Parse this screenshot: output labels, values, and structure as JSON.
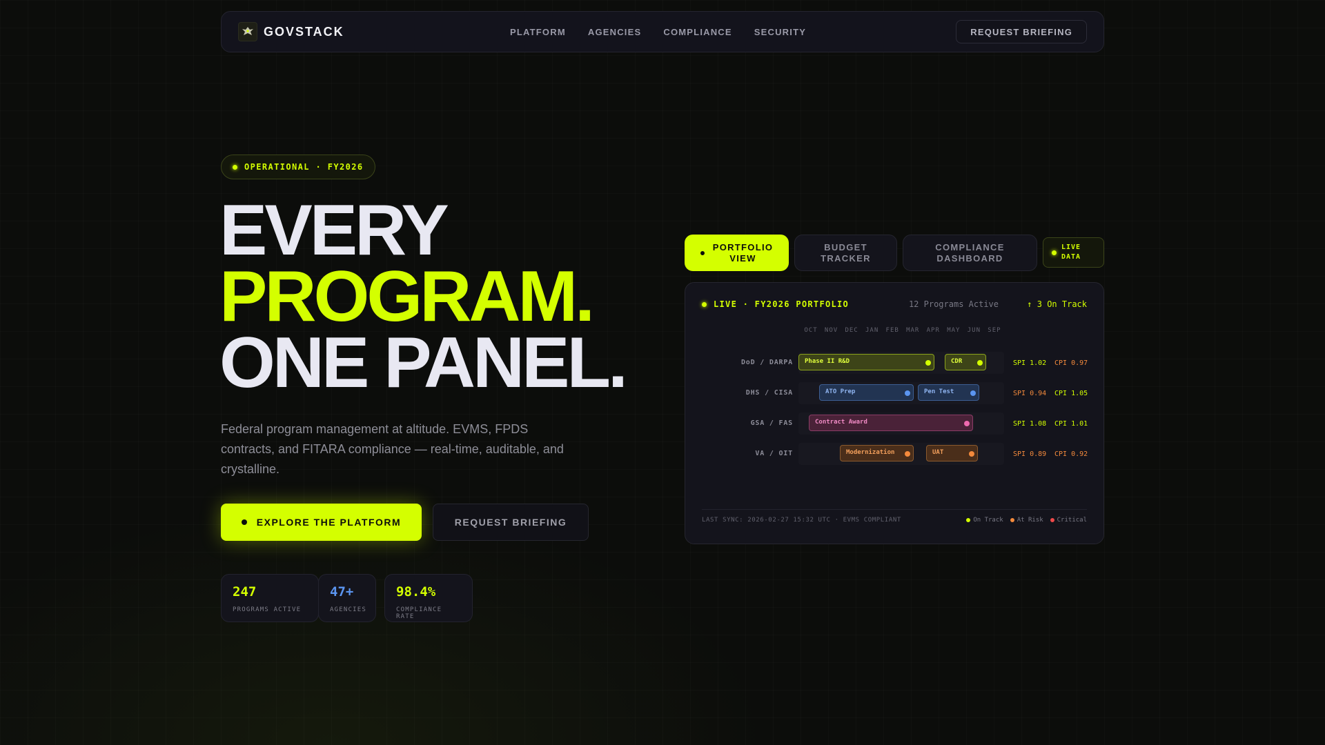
{
  "nav": {
    "brand": "GOVSTACK",
    "links": [
      "PLATFORM",
      "AGENCIES",
      "COMPLIANCE",
      "SECURITY"
    ],
    "cta": "REQUEST BRIEFING"
  },
  "hero": {
    "badge": "OPERATIONAL · FY2026",
    "line1": "EVERY",
    "line2": "PROGRAM.",
    "line3": "ONE PANEL.",
    "subtitle": "Federal program management at altitude. EVMS, FPDS contracts, and FITARA compliance — real-time, auditable, and crystalline.",
    "primary_cta": "EXPLORE THE PLATFORM",
    "secondary_cta": "REQUEST BRIEFING",
    "stats": [
      {
        "value": "247",
        "label": "PROGRAMS ACTIVE",
        "color": "#d4ff00"
      },
      {
        "value": "47+",
        "label": "AGENCIES",
        "color": "#5b95f0"
      },
      {
        "value": "98.4%",
        "label": "COMPLIANCE RATE",
        "color": "#d4ff00"
      }
    ]
  },
  "tabs": {
    "items": [
      {
        "line1": "PORTFOLIO",
        "line2": "VIEW",
        "active": true
      },
      {
        "line1": "BUDGET",
        "line2": "TRACKER",
        "active": false
      },
      {
        "line1": "COMPLIANCE",
        "line2": "DASHBOARD",
        "active": false
      }
    ],
    "live": {
      "line1": "LIVE",
      "line2": "DATA"
    }
  },
  "panel": {
    "title": "LIVE · FY2026 PORTFOLIO",
    "count": "12 Programs Active",
    "on_track": "↑ 3 On Track",
    "months": [
      "OCT",
      "NOV",
      "DEC",
      "JAN",
      "FEB",
      "MAR",
      "APR",
      "MAY",
      "JUN",
      "SEP"
    ],
    "rows": [
      {
        "label": "DoD / DARPA",
        "spi": "SPI 1.02",
        "cpi": "CPI 0.97",
        "spi_color": "#d4ff00",
        "cpi_color": "#f48a3c",
        "bars": [
          {
            "name": "Phase II R&D",
            "style": "green",
            "start": 0.0,
            "end": 0.66
          },
          {
            "name": "CDR",
            "style": "green",
            "start": 0.71,
            "end": 0.91
          }
        ]
      },
      {
        "label": "DHS / CISA",
        "spi": "SPI 0.94",
        "cpi": "CPI 1.05",
        "spi_color": "#f48a3c",
        "cpi_color": "#d4ff00",
        "bars": [
          {
            "name": "ATO Prep",
            "style": "blue",
            "start": 0.1,
            "end": 0.56
          },
          {
            "name": "Pen Test",
            "style": "blue",
            "start": 0.58,
            "end": 0.88
          }
        ]
      },
      {
        "label": "GSA / FAS",
        "spi": "SPI 1.08",
        "cpi": "CPI 1.01",
        "spi_color": "#d4ff00",
        "cpi_color": "#d4ff00",
        "bars": [
          {
            "name": "Contract Award",
            "style": "pink",
            "start": 0.05,
            "end": 0.85
          }
        ]
      },
      {
        "label": "VA / OIT",
        "spi": "SPI 0.89",
        "cpi": "CPI 0.92",
        "spi_color": "#f48a3c",
        "cpi_color": "#f48a3c",
        "bars": [
          {
            "name": "Modernization",
            "style": "orange",
            "start": 0.2,
            "end": 0.56
          },
          {
            "name": "UAT",
            "style": "orange",
            "start": 0.62,
            "end": 0.87
          }
        ]
      }
    ],
    "sync": "LAST SYNC: 2026-02-27 15:32 UTC · EVMS COMPLIANT",
    "legend": [
      {
        "label": "On Track",
        "color": "#d4ff00"
      },
      {
        "label": "At Risk",
        "color": "#f48a3c"
      },
      {
        "label": "Critical",
        "color": "#ef4a4a"
      }
    ]
  }
}
